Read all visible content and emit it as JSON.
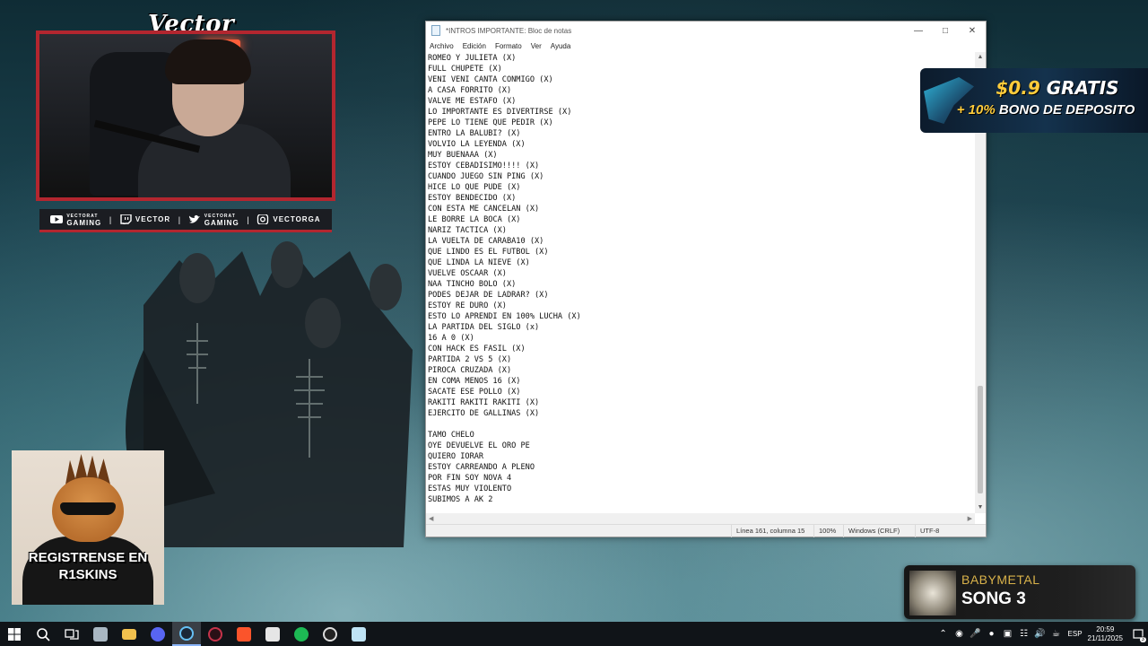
{
  "overlay": {
    "brand": "Vector",
    "socials": [
      {
        "icon": "youtube-icon",
        "small": "VECTORAT",
        "label": "GAMING"
      },
      {
        "icon": "twitch-icon",
        "small": "",
        "label": "VECTOR"
      },
      {
        "icon": "twitter-icon",
        "small": "VECTORAT",
        "label": "GAMING"
      },
      {
        "icon": "instagram-icon",
        "small": "",
        "label": "VECTORGA"
      }
    ],
    "ad": {
      "amount": "$0.9",
      "free": "GRATIS",
      "bonus_pct": "+ 10%",
      "bonus_text": "BONO DE DEPOSITO"
    },
    "cat_text_line1": "REGISTRENSE EN",
    "cat_text_line2": "R1SKINS",
    "now_playing": {
      "artist": "BABYMETAL",
      "song": "SONG 3"
    }
  },
  "notepad": {
    "title": "*INTROS IMPORTANTE: Bloc de notas",
    "menu": [
      "Archivo",
      "Edición",
      "Formato",
      "Ver",
      "Ayuda"
    ],
    "lines": [
      "ROMEO Y JULIETA (X)",
      "FULL CHUPETE (X)",
      "VENI VENI CANTA CONMIGO (X)",
      "A CASA FORRITO (X)",
      "VALVE ME ESTAFO (X)",
      "LO IMPORTANTE ES DIVERTIRSE (X)",
      "PEPE LO TIENE QUE PEDIR (X)",
      "ENTRO LA BALUBI? (X)",
      "VOLVIO LA LEYENDA (X)",
      "MUY BUENAAA (X)",
      "ESTOY CEBADISIMO!!!! (X)",
      "CUANDO JUEGO SIN PING (X)",
      "HICE LO QUE PUDE (X)",
      "ESTOY BENDECIDO (X)",
      "CON ESTA ME CANCELAN (X)",
      "LE BORRE LA BOCA (X)",
      "NARIZ TACTICA (X)",
      "LA VUELTA DE CARABA10 (X)",
      "QUE LINDO ES EL FUTBOL (X)",
      "QUE LINDA LA NIEVE (X)",
      "VUELVE OSCAAR (X)",
      "NAA TINCHO BOLO (X)",
      "PODES DEJAR DE LADRAR? (X)",
      "ESTOY RE DURO (X)",
      "ESTO LO APRENDI EN 100% LUCHA (X)",
      "LA PARTIDA DEL SIGLO (x)",
      "16 A 0 (X)",
      "CON HACK ES FASIL (X)",
      "PARTIDA 2 VS 5 (X)",
      "PIROCA CRUZADA (X)",
      "EN COMA MENOS 16 (X)",
      "SACATE ESE POLLO (X)",
      "RAKITI RAKITI RAKITI (X)",
      "EJERCITO DE GALLINAS (X)",
      "",
      "TAMO CHELO",
      "OYE DEVUELVE EL ORO PE",
      "QUIERO IORAR",
      "ESTOY CARREANDO A PLENO",
      "POR FIN SOY NOVA 4",
      "ESTAS MUY VIOLENTO",
      "SUBIMOS A AK 2"
    ],
    "status": {
      "position": "Línea 161, columna 15",
      "zoom": "100%",
      "eol": "Windows (CRLF)",
      "encoding": "UTF-8"
    }
  },
  "taskbar": {
    "apps": [
      "start-icon",
      "search-icon",
      "task-view-icon",
      "file-explorer-icon",
      "folder-icon",
      "discord-icon",
      "steam-icon",
      "record-icon",
      "brave-icon",
      "game-launcher-icon",
      "spotify-icon",
      "obs-icon",
      "notepad-icon"
    ],
    "language": "ESP",
    "time": "20:59",
    "date": "21/11/2025",
    "notifications": "3"
  }
}
